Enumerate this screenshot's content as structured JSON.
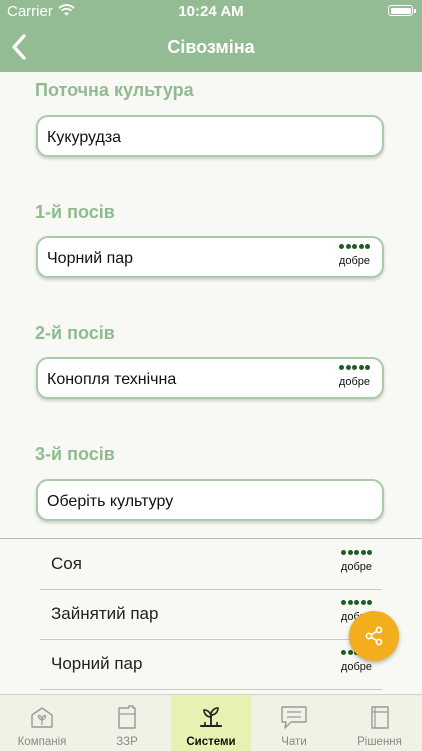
{
  "status_bar": {
    "carrier": "Carrier",
    "time": "10:24 AM"
  },
  "nav": {
    "title": "Сівозміна"
  },
  "sections": [
    {
      "title": "Поточна культура",
      "value": "Кукурудза"
    },
    {
      "title": "1-й посів",
      "value": "Чорний пар",
      "rating": 5,
      "rating_label": "добре"
    },
    {
      "title": "2-й посів",
      "value": "Конопля технічна",
      "rating": 5,
      "rating_label": "добре"
    },
    {
      "title": "3-й посів",
      "value": "Оберіть культуру"
    }
  ],
  "dropdown": {
    "items": [
      {
        "name": "Соя",
        "rating": 5,
        "rating_label": "добре"
      },
      {
        "name": "Зайнятий пар",
        "rating": 5,
        "rating_label": "добре"
      },
      {
        "name": "Чорний пар",
        "rating": 5,
        "rating_label": "добре"
      }
    ]
  },
  "fab": {
    "icon": "share-icon",
    "color": "#f2ae1c"
  },
  "tabs": [
    {
      "label": "Компанія",
      "icon": "home-plant-icon"
    },
    {
      "label": "ЗЗР",
      "icon": "canister-icon"
    },
    {
      "label": "Системи",
      "icon": "seedling-icon",
      "active": true
    },
    {
      "label": "Чати",
      "icon": "chat-icon"
    },
    {
      "label": "Рішення",
      "icon": "book-icon"
    }
  ],
  "colors": {
    "header": "#94bc94",
    "section_title": "#8fbb8f",
    "field_border": "#a9cba9",
    "rating_dot": "#1d5c23",
    "active_tab": "#e6f1b2"
  }
}
